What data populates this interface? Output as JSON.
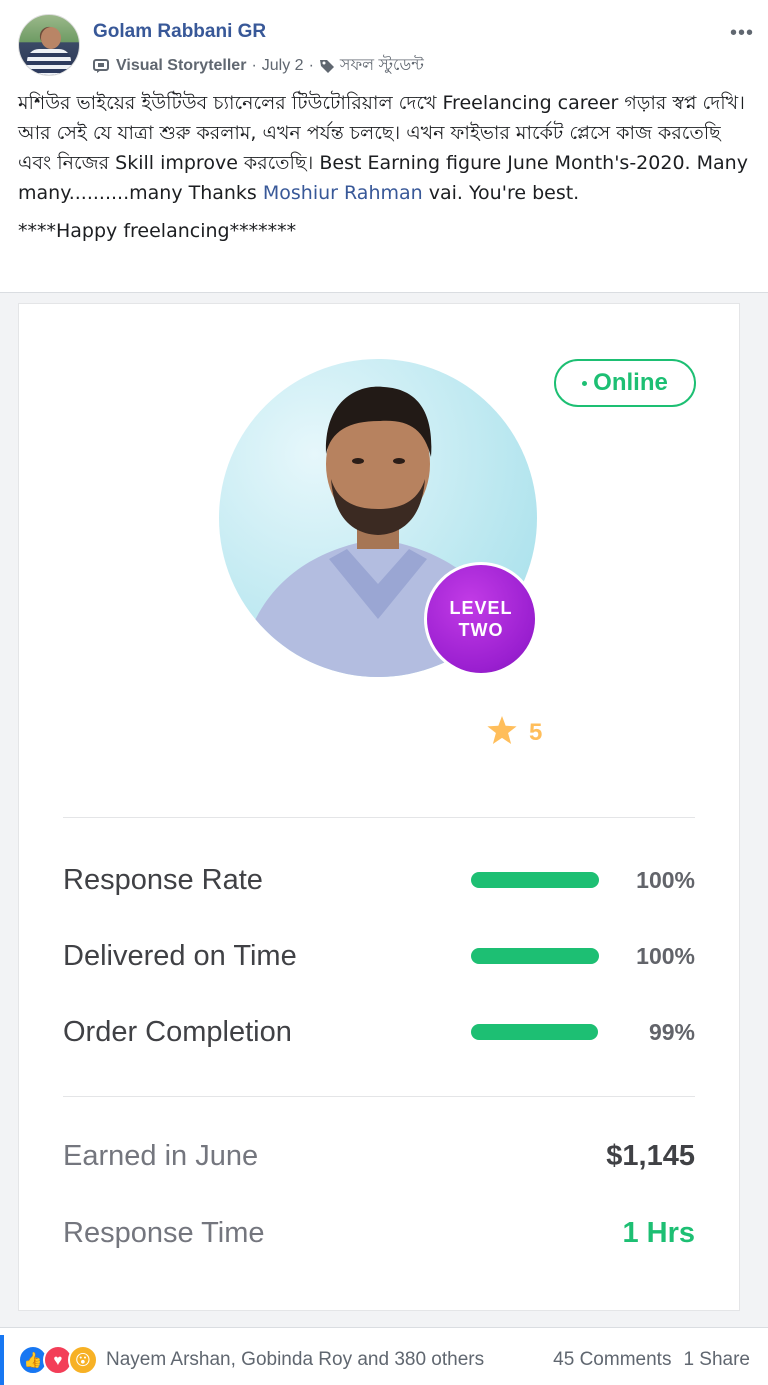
{
  "post": {
    "author": "Golam Rabbani GR",
    "badge": "Visual Storyteller",
    "date": "July 2",
    "tag": "সফল স্টুডেন্ট",
    "more_icon": "more-horizontal-icon",
    "paragraph1_part1": "মশিউর ভাইয়ের ইউটিউব চ্যানেলের টিউটোরিয়াল দেখে Freelancing career গড়ার স্বপ্ন দেখি। আর সেই যে যাত্রা শুরু করলাম, এখন পর্যন্ত চলছে। এখন ফাইভার মার্কেট প্লেসে কাজ করতেছি এবং নিজের Skill improve করতেছি। Best Earning figure June Month's-2020. Many many..........many Thanks ",
    "mention": "Moshiur Rahman",
    "paragraph1_part2": " vai. You're best.",
    "paragraph2": "****Happy freelancing*******"
  },
  "card": {
    "status": "Online",
    "level_line1": "LEVEL",
    "level_line2": "TWO",
    "rating": "5",
    "stats": [
      {
        "label": "Response Rate",
        "value": "100%",
        "fraction": 1.0
      },
      {
        "label": "Delivered on Time",
        "value": "100%",
        "fraction": 1.0
      },
      {
        "label": "Order Completion",
        "value": "99%",
        "fraction": 0.99
      }
    ],
    "earned_label": "Earned in June",
    "earned_value": "$1,145",
    "response_time_label": "Response Time",
    "response_time_value": "1 Hrs",
    "colors": {
      "green": "#1dbf73",
      "purple": "#9a1fd0",
      "star": "#ffbe5b"
    }
  },
  "footer": {
    "reactors": "Nayem Arshan, Gobinda Roy and 380 others",
    "comments": "45 Comments",
    "shares": "1 Share",
    "reaction_icons": [
      "like-icon",
      "love-icon",
      "wow-icon"
    ]
  }
}
